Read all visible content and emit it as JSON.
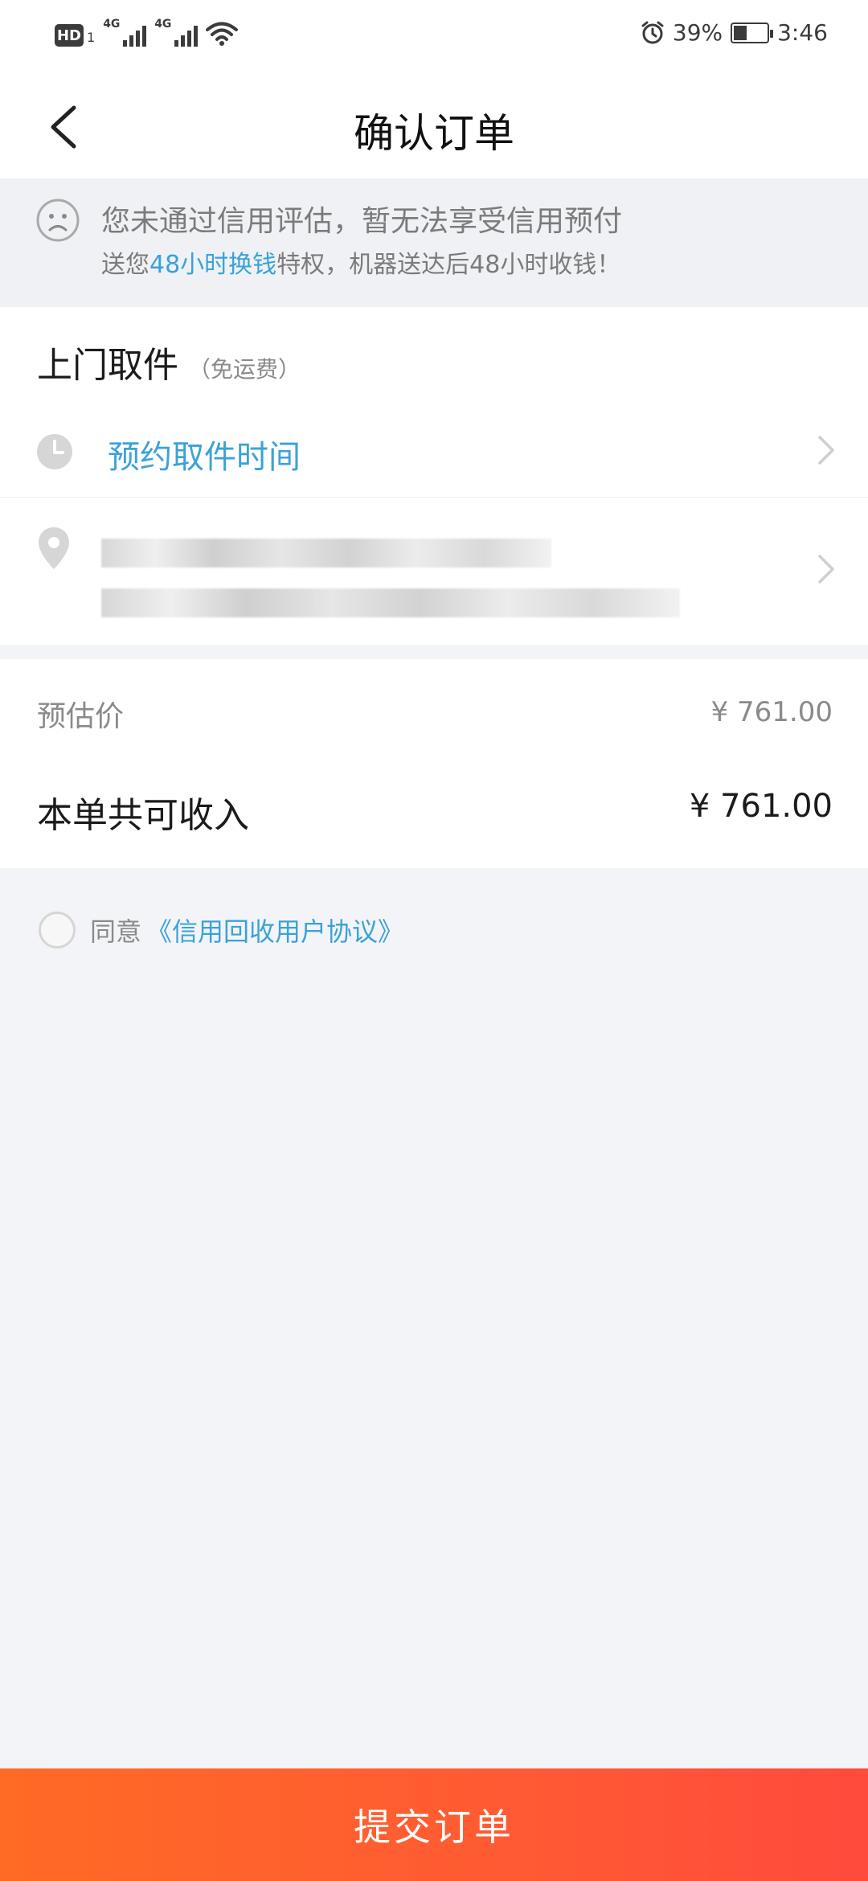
{
  "status_bar": {
    "hd": "HD",
    "sim": "1",
    "net1": "4G",
    "net2": "4G",
    "battery": "39%",
    "time": "3:46",
    "battery_level": 0.39
  },
  "header": {
    "title": "确认订单"
  },
  "notice": {
    "line1": "您未通过信用评估，暂无法享受信用预付",
    "line2_prefix": "送您",
    "line2_highlight": "48小时换钱",
    "line2_suffix": "特权，机器送达后48小时收钱！"
  },
  "pickup": {
    "title": "上门取件",
    "subtitle": "（免运费）",
    "time_placeholder": "预约取件时间"
  },
  "price": {
    "estimate_label": "预估价",
    "estimate_value": "¥ 761.00",
    "income_label": "本单共可收入",
    "income_value": "¥ 761.00"
  },
  "agreement": {
    "prefix": "同意",
    "link": "《信用回收用户协议》"
  },
  "footer": {
    "submit_label": "提交订单"
  },
  "colors": {
    "accent_blue": "#3aa2d8",
    "submit_gradient_start": "#ff6a24",
    "submit_gradient_end": "#ff4a3c",
    "page_bg": "#f3f4f8"
  }
}
